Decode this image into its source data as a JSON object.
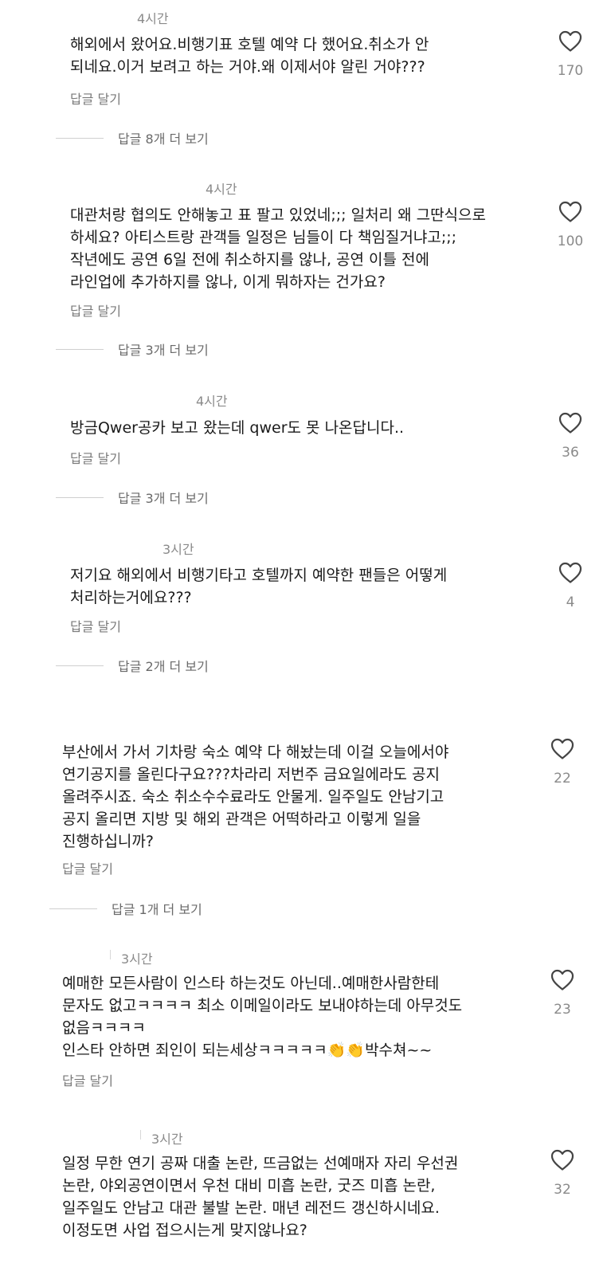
{
  "comments": [
    {
      "time": "4시간",
      "text": "해외에서 왔어요.비행기표 호텔 예약 다 했어요.취소가 안\n되네요.이거 보려고 하는 거야.왜 이제서야 알린 거야???",
      "reply_label": "답글 달기",
      "likes": "170",
      "more_replies": "답글 8개 더 보기"
    },
    {
      "time": "4시간",
      "text": "대관처랑 협의도 안해놓고 표 팔고 있었네;;; 일처리 왜 그딴식으로\n하세요? 아티스트랑 관객들 일정은 님들이 다 책임질거냐고;;;\n작년에도 공연 6일 전에 취소하지를 않나, 공연 이틀 전에\n라인업에 추가하지를 않나, 이게 뭐하자는 건가요?",
      "reply_label": "답글 달기",
      "likes": "100",
      "more_replies": "답글 3개 더 보기"
    },
    {
      "time": "4시간",
      "text": "방금Qwer공카 보고 왔는데 qwer도 못 나온답니다..",
      "reply_label": "답글 달기",
      "likes": "36",
      "more_replies": "답글 3개 더 보기"
    },
    {
      "time": "3시간",
      "text": "저기요 해외에서 비행기타고 호텔까지 예약한 팬들은 어떻게\n처리하는거에요???",
      "reply_label": "답글 달기",
      "likes": "4",
      "more_replies": "답글 2개 더 보기"
    },
    {
      "time": "",
      "text": "부산에서 가서 기차랑 숙소 예약 다 해놨는데 이걸 오늘에서야\n연기공지를 올린다구요???차라리 저번주 금요일에라도 공지\n올려주시죠. 숙소 취소수수료라도 안물게. 일주일도 안남기고\n공지 올리면 지방 및 해외 관객은 어떡하라고 이렇게 일을\n진행하십니까?",
      "reply_label": "답글 달기",
      "likes": "22",
      "more_replies": "답글 1개 더 보기"
    },
    {
      "time": "3시간",
      "text": "예매한 모든사람이 인스타 하는것도 아닌데..예매한사람한테\n문자도 없고ㅋㅋㅋㅋ 최소 이메일이라도 보내야하는데 아무것도\n없음ㅋㅋㅋㅋ\n인스타 안하면 죄인이 되는세상ㅋㅋㅋㅋㅋ👏👏박수쳐~~",
      "reply_label": "답글 달기",
      "likes": "23",
      "more_replies": ""
    },
    {
      "time": "3시간",
      "text": "일정 무한 연기 공짜 대출 논란, 뜨금없는 선예매자 자리 우선권\n논란, 야외공연이면서 우천 대비 미흡 논란, 굿즈 미흡 논란,\n일주일도 안남고 대관 불발 논란. 매년 레전드 갱신하시네요.\n이정도면 사업 접으시는게 맞지않나요?",
      "reply_label": "",
      "likes": "32",
      "more_replies": ""
    }
  ],
  "icons": {
    "like": "heart-outline-icon"
  },
  "colors": {
    "text": "#1a1a1a",
    "muted": "#8a8a8a",
    "divider": "#cfcfcf"
  }
}
